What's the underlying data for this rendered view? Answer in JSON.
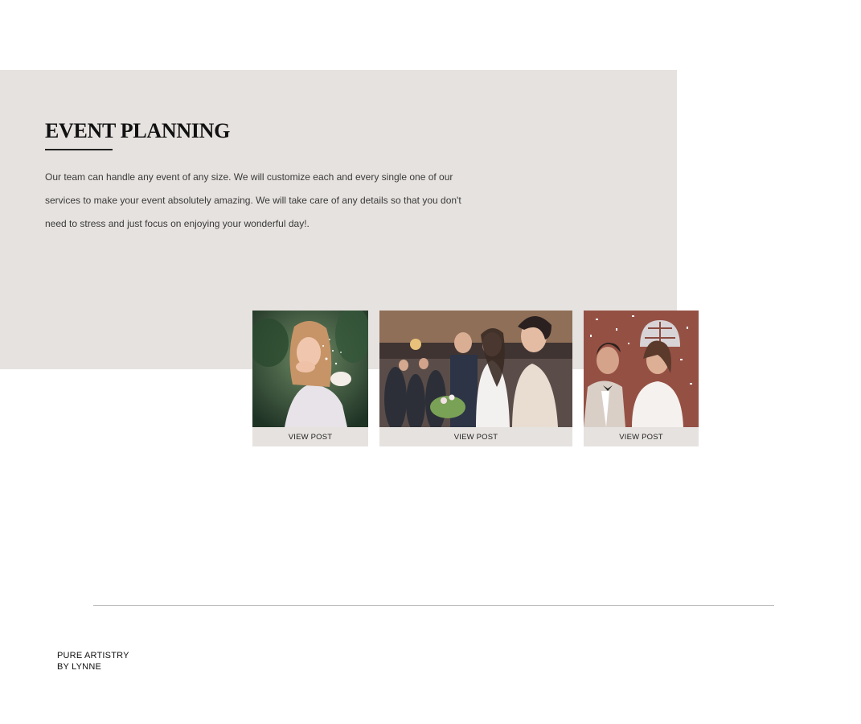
{
  "section": {
    "title": "EVENT PLANNING",
    "description": "Our team can handle any event of any size. We will customize each and every single one of our services to make your event absolutely amazing.  We will take care of any details so that you don't need to stress and just focus on enjoying your wonderful day!."
  },
  "posts": [
    {
      "image": "bride-blowing-glitter-photo",
      "link_label": "VIEW POST"
    },
    {
      "image": "bride-walking-aisle-photo",
      "link_label": "VIEW POST"
    },
    {
      "image": "couple-confetti-photo",
      "link_label": "VIEW POST"
    }
  ],
  "footer": {
    "brand_line1": "PURE ARTISTRY",
    "brand_line2": "BY LYNNE"
  },
  "colors": {
    "panel_background": "#e6e2df",
    "divider": "#b9b9b9",
    "text": "#222222"
  }
}
